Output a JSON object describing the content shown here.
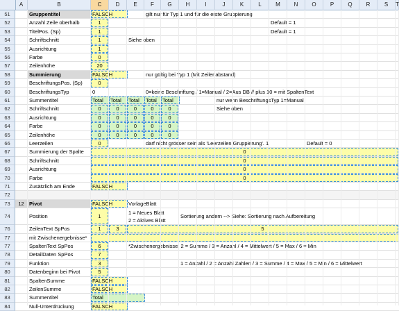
{
  "columns": [
    "A",
    "B",
    "C",
    "D",
    "E",
    "F",
    "G",
    "H",
    "I",
    "J",
    "K",
    "L",
    "M",
    "N",
    "O",
    "P",
    "Q",
    "R",
    "S",
    "T"
  ],
  "rows": [
    {
      "n": "51",
      "cells": [
        {
          "c": "B",
          "t": "Gruppentitel",
          "b": true,
          "bg": "gray"
        },
        {
          "c": "C",
          "t": "FALSCH",
          "bg": "y",
          "w": 2
        },
        {
          "c": "F",
          "t": "gilt nur für Typ 1 und für die erste Gruppierung"
        }
      ]
    },
    {
      "n": "52",
      "cells": [
        {
          "c": "B",
          "t": "Anzahl Zeile oberhalb"
        },
        {
          "c": "C",
          "t": "1",
          "bg": "y",
          "ctr": true
        },
        {
          "c": "M",
          "t": "Default = 1"
        }
      ]
    },
    {
      "n": "53",
      "cells": [
        {
          "c": "B",
          "t": "TitelPos. (Sp)"
        },
        {
          "c": "C",
          "t": "1",
          "bg": "y",
          "ctr": true
        },
        {
          "c": "M",
          "t": "Default = 1"
        }
      ]
    },
    {
      "n": "54",
      "cells": [
        {
          "c": "B",
          "t": "Schriftschnitt"
        },
        {
          "c": "C",
          "t": "1",
          "bg": "y",
          "ctr": true
        },
        {
          "c": "E",
          "t": "Siehe oben"
        }
      ]
    },
    {
      "n": "55",
      "cells": [
        {
          "c": "B",
          "t": "Ausrichtung"
        },
        {
          "c": "C",
          "t": "1",
          "bg": "y",
          "ctr": true
        }
      ]
    },
    {
      "n": "56",
      "cells": [
        {
          "c": "B",
          "t": "Farbe"
        },
        {
          "c": "C",
          "t": "0",
          "bg": "y",
          "ctr": true
        }
      ]
    },
    {
      "n": "57",
      "cells": [
        {
          "c": "B",
          "t": "Zeilenhöhe"
        },
        {
          "c": "C",
          "t": "20",
          "bg": "y",
          "ctr": true
        }
      ]
    },
    {
      "n": "58",
      "cells": [
        {
          "c": "B",
          "t": "Summierung",
          "b": true,
          "bg": "gray"
        },
        {
          "c": "C",
          "t": "FALSCH",
          "bg": "y",
          "w": 2
        },
        {
          "c": "F",
          "t": "nur gültig bei Typ 1 (Mit Zeilenabstand)"
        }
      ]
    },
    {
      "n": "59",
      "cells": [
        {
          "c": "B",
          "t": "BeschriftungsPos. (Sp)"
        },
        {
          "c": "C",
          "t": "0",
          "bg": "y",
          "ctr": true
        }
      ]
    },
    {
      "n": "60",
      "cells": [
        {
          "c": "B",
          "t": "BeschriftungsTyp"
        },
        {
          "c": "C",
          "t": "0"
        },
        {
          "c": "F",
          "t": "0=keine Beschriftung / 1=Manual / 2=Aus DB  //  plus 10 = mit SpaltenText"
        }
      ]
    },
    {
      "n": "61",
      "cells": [
        {
          "c": "B",
          "t": "Summentitel"
        },
        {
          "c": "C",
          "t": "Total",
          "bg": "g"
        },
        {
          "c": "D",
          "t": "Total",
          "bg": "g"
        },
        {
          "c": "E",
          "t": "Total",
          "bg": "g"
        },
        {
          "c": "F",
          "t": "Total",
          "bg": "g"
        },
        {
          "c": "G",
          "t": "Total",
          "bg": "g"
        },
        {
          "c": "J",
          "t": "nur wenn BeschriftungsTyp 1=Manual"
        }
      ]
    },
    {
      "n": "62",
      "cells": [
        {
          "c": "B",
          "t": "Schriftschnitt"
        },
        {
          "c": "C",
          "t": "0",
          "bg": "g",
          "ctr": true
        },
        {
          "c": "D",
          "t": "0",
          "bg": "g",
          "ctr": true
        },
        {
          "c": "E",
          "t": "0",
          "bg": "g",
          "ctr": true
        },
        {
          "c": "F",
          "t": "0",
          "bg": "g",
          "ctr": true
        },
        {
          "c": "G",
          "t": "0",
          "bg": "g",
          "ctr": true
        },
        {
          "c": "J",
          "t": "Siehe oben"
        }
      ]
    },
    {
      "n": "63",
      "cells": [
        {
          "c": "B",
          "t": "Ausrichtung"
        },
        {
          "c": "C",
          "t": "0",
          "bg": "g",
          "ctr": true
        },
        {
          "c": "D",
          "t": "0",
          "bg": "g",
          "ctr": true
        },
        {
          "c": "E",
          "t": "0",
          "bg": "g",
          "ctr": true
        },
        {
          "c": "F",
          "t": "0",
          "bg": "g",
          "ctr": true
        },
        {
          "c": "G",
          "t": "0",
          "bg": "g",
          "ctr": true
        }
      ]
    },
    {
      "n": "64",
      "cells": [
        {
          "c": "B",
          "t": "Farbe"
        },
        {
          "c": "C",
          "t": "0",
          "bg": "g",
          "ctr": true
        },
        {
          "c": "D",
          "t": "0",
          "bg": "g",
          "ctr": true
        },
        {
          "c": "E",
          "t": "0",
          "bg": "g",
          "ctr": true
        },
        {
          "c": "F",
          "t": "0",
          "bg": "g",
          "ctr": true
        },
        {
          "c": "G",
          "t": "0",
          "bg": "g",
          "ctr": true
        }
      ]
    },
    {
      "n": "65",
      "cells": [
        {
          "c": "B",
          "t": "Zeilenhöhe"
        },
        {
          "c": "C",
          "t": "0",
          "bg": "g",
          "ctr": true
        },
        {
          "c": "D",
          "t": "0",
          "bg": "g",
          "ctr": true
        },
        {
          "c": "E",
          "t": "0",
          "bg": "g",
          "ctr": true
        },
        {
          "c": "F",
          "t": "0",
          "bg": "g",
          "ctr": true
        },
        {
          "c": "G",
          "t": "0",
          "bg": "g",
          "ctr": true
        }
      ]
    },
    {
      "n": "66",
      "cells": [
        {
          "c": "B",
          "t": "Leerzeilen"
        },
        {
          "c": "C",
          "t": "0",
          "bg": "y",
          "ctr": true
        },
        {
          "c": "F",
          "t": "darf nicht grösser sein als 'Leerzeilen Gruppierung'. 1"
        },
        {
          "c": "O",
          "t": "Default = 0"
        }
      ]
    },
    {
      "n": "67",
      "cells": [
        {
          "c": "B",
          "t": "Summierung der Spalte"
        },
        {
          "c": "C",
          "t": "0",
          "bg": "y",
          "ctr": true,
          "w": 18
        }
      ]
    },
    {
      "n": "68",
      "cells": [
        {
          "c": "B",
          "t": "Schriftschnitt"
        },
        {
          "c": "C",
          "t": "0",
          "bg": "y",
          "ctr": true,
          "w": 18
        }
      ]
    },
    {
      "n": "69",
      "cells": [
        {
          "c": "B",
          "t": "Ausrichtung"
        },
        {
          "c": "C",
          "t": "0",
          "bg": "y",
          "ctr": true,
          "w": 18
        }
      ]
    },
    {
      "n": "70",
      "cells": [
        {
          "c": "B",
          "t": "Farbe"
        },
        {
          "c": "C",
          "t": "0",
          "bg": "y",
          "ctr": true,
          "w": 18
        }
      ]
    },
    {
      "n": "71",
      "cells": [
        {
          "c": "B",
          "t": "Zusätzlich am Ende"
        },
        {
          "c": "C",
          "t": "FALSCH",
          "bg": "y",
          "w": 2
        }
      ]
    },
    {
      "n": "72",
      "cells": [],
      "sep": true
    },
    {
      "n": "73",
      "cells": [
        {
          "c": "A",
          "t": "12",
          "ctr": true,
          "bg": "gray"
        },
        {
          "c": "B",
          "t": "Pivot",
          "b": true,
          "bg": "gray"
        },
        {
          "c": "C",
          "t": "FALSCH",
          "bg": "y",
          "w": 2
        },
        {
          "c": "E",
          "t": "VorlageBlatt"
        }
      ]
    },
    {
      "n": "74",
      "cells": [
        {
          "c": "B",
          "t": "Position"
        },
        {
          "c": "C",
          "t": "1",
          "bg": "y",
          "ctr": true
        },
        {
          "c": "E",
          "t": "1 = Neues Blatt"
        },
        {
          "c": "H",
          "t": "Sortierung andern --> Siehe: Sortierung nach Aufbereitung"
        }
      ],
      "tall": true,
      "line2": "2 = Aktives Blatt"
    },
    {
      "n": "76",
      "cells": [
        {
          "c": "B",
          "t": "ZeilenText  SpPos"
        },
        {
          "c": "C",
          "t": "1",
          "bg": "y",
          "ctr": true
        },
        {
          "c": "D",
          "t": "3",
          "bg": "y",
          "ctr": true
        },
        {
          "c": "E",
          "t": "5",
          "bg": "y",
          "ctr": true,
          "w": 16
        }
      ]
    },
    {
      "n": "77",
      "cells": [
        {
          "c": "B",
          "t": "mit Zwischenergebnisse*"
        },
        {
          "c": "C",
          "t": "",
          "bg": "y",
          "w": 18
        }
      ]
    },
    {
      "n": "77b",
      "label": "77",
      "cells": [
        {
          "c": "B",
          "t": "SpaltenText  SpPos"
        },
        {
          "c": "C",
          "t": "6",
          "bg": "y",
          "ctr": true
        },
        {
          "c": "E",
          "t": "*Zwischenergebnisse: 2 = Summe  / 3 = Anzahl  / 4 = Mittelwert  / 5 = Max  /  6 = Min"
        }
      ]
    },
    {
      "n": "78",
      "cells": [
        {
          "c": "B",
          "t": "DetailDaten  SpPos"
        },
        {
          "c": "C",
          "t": "7",
          "bg": "y",
          "ctr": true
        }
      ]
    },
    {
      "n": "79",
      "cells": [
        {
          "c": "B",
          "t": "Funktion"
        },
        {
          "c": "C",
          "t": "3",
          "bg": "y",
          "ctr": true
        },
        {
          "c": "H",
          "t": "1 = Anzahl / 2 = Anzahl Zahlen / 3 = Summe / 4 = Max / 5 = Min / 6 = Mittelwert"
        }
      ]
    },
    {
      "n": "80",
      "cells": [
        {
          "c": "B",
          "t": "Datenbeginn bei Pivot"
        },
        {
          "c": "C",
          "t": "5",
          "bg": "y",
          "ctr": true
        }
      ]
    },
    {
      "n": "81",
      "cells": [
        {
          "c": "B",
          "t": "SpaltenSumme"
        },
        {
          "c": "C",
          "t": "FALSCH",
          "bg": "y",
          "w": 2
        }
      ]
    },
    {
      "n": "82",
      "cells": [
        {
          "c": "B",
          "t": "ZeilenSumme"
        },
        {
          "c": "C",
          "t": "FALSCH",
          "bg": "y",
          "w": 2
        }
      ]
    },
    {
      "n": "83",
      "cells": [
        {
          "c": "B",
          "t": "Summentitel"
        },
        {
          "c": "C",
          "t": "Total",
          "bg": "g",
          "w": 3
        }
      ]
    },
    {
      "n": "84",
      "cells": [
        {
          "c": "B",
          "t": "Null-Unterdrückung"
        },
        {
          "c": "C",
          "t": "FALSCH",
          "bg": "y",
          "w": 2
        }
      ]
    }
  ]
}
